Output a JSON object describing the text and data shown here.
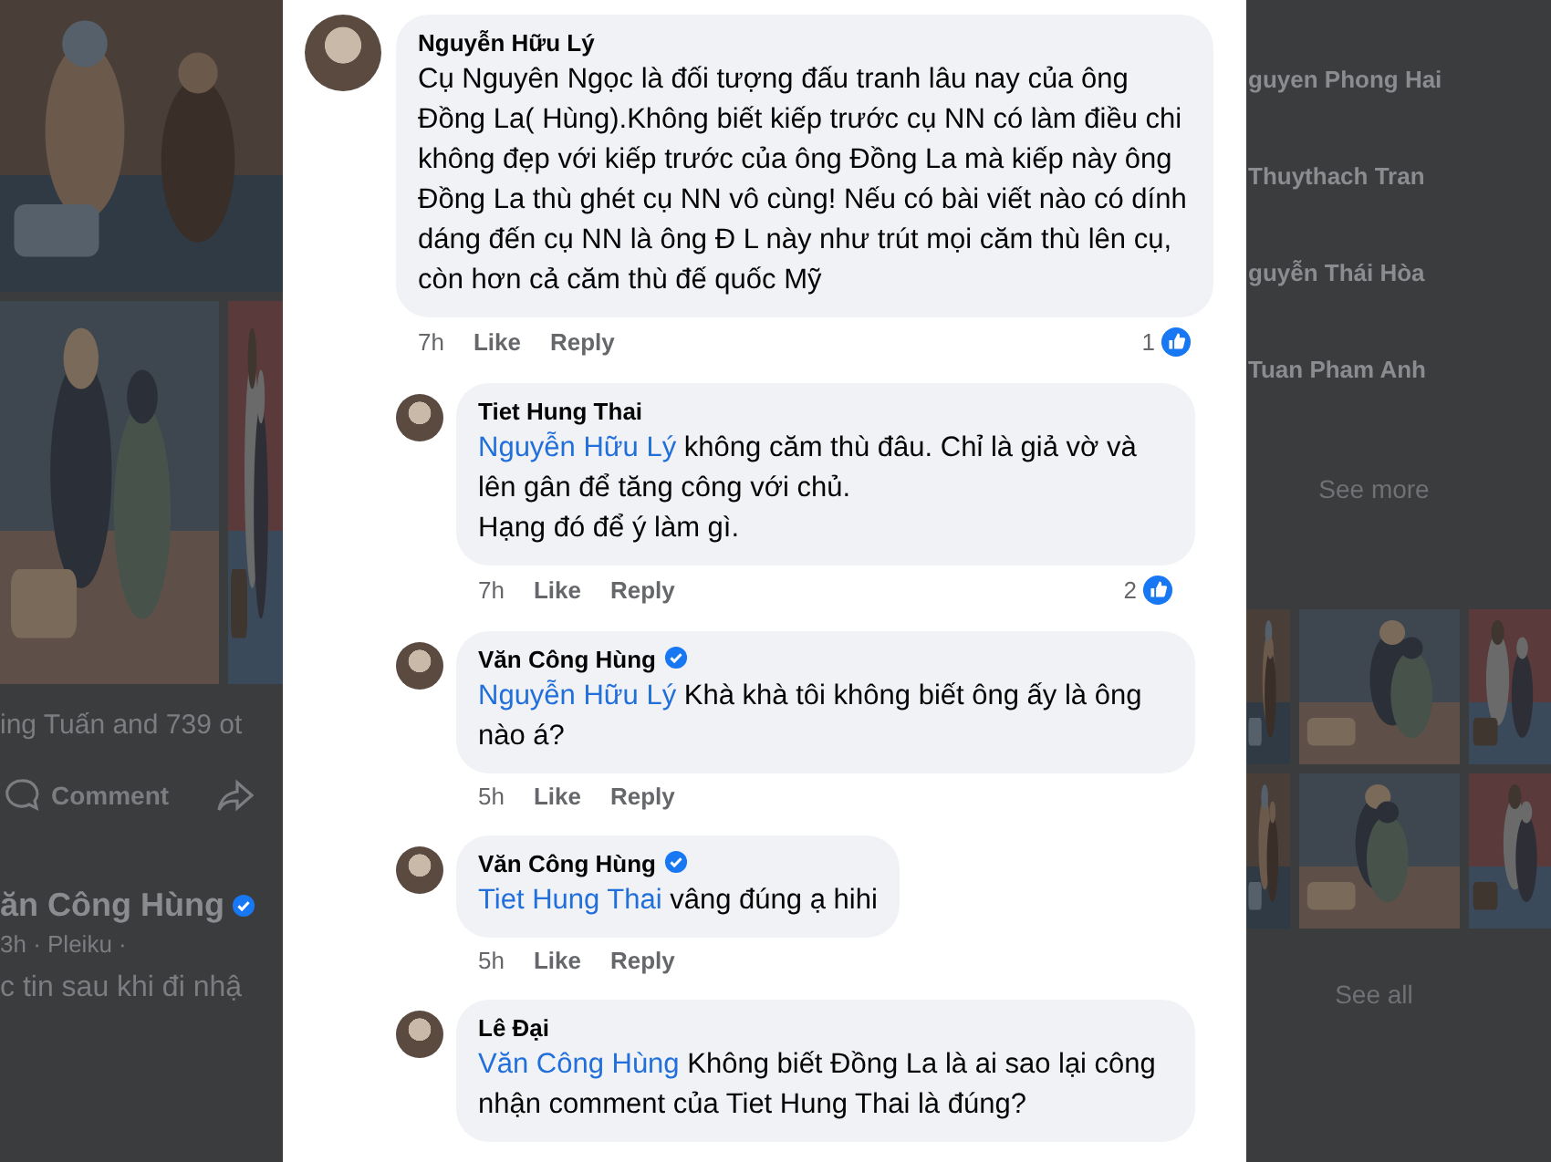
{
  "background_post": {
    "likes_text": "ing Tuấn and 739 ot",
    "comment_button": "Comment",
    "author": "ăn Công Hùng",
    "author_verified": true,
    "meta": "3h · Pleiku ·",
    "text": "c tin sau khi đi nhậ"
  },
  "sidebar": {
    "people": [
      {
        "name": "guyen Phong Hai"
      },
      {
        "name": "Thuythach Tran"
      },
      {
        "name": "guyễn Thái Hòa"
      },
      {
        "name": "Tuan Pham Anh"
      }
    ],
    "see_more": "See more",
    "see_all": "See all"
  },
  "comments": [
    {
      "author": "Nguyễn Hữu Lý",
      "verified": false,
      "reply": false,
      "text": "Cụ Nguyên Ngọc là đối tượng đấu tranh lâu nay của ông Đồng La( Hùng).Không biết kiếp trước cụ NN có làm điều chi không đẹp với kiếp trước của ông Đồng La mà kiếp này ông Đồng La  thù ghét cụ NN vô cùng! Nếu có bài viết nào có dính dáng  đến cụ NN là ông Đ L này như trút mọi căm thù lên cụ, còn hơn cả căm thù đế quốc Mỹ",
      "time": "7h",
      "like": "Like",
      "reply_label": "Reply",
      "reactions": "1"
    },
    {
      "author": "Tiet Hung Thai",
      "verified": false,
      "reply": true,
      "mention": "Nguyễn Hữu Lý",
      "text": "không căm thù đâu. Chỉ là giả vờ và lên gân để tăng công với chủ.\nHạng đó để ý làm gì.",
      "time": "7h",
      "like": "Like",
      "reply_label": "Reply",
      "reactions": "2"
    },
    {
      "author": "Văn Công Hùng",
      "verified": true,
      "reply": true,
      "mention": "Nguyễn Hữu Lý",
      "text": "Khà khà tôi không biết ông ấy là ông nào á?",
      "time": "5h",
      "like": "Like",
      "reply_label": "Reply"
    },
    {
      "author": "Văn Công Hùng",
      "verified": true,
      "reply": true,
      "mention": "Tiet Hung Thai",
      "text": "vâng đúng ạ hihi",
      "time": "5h",
      "like": "Like",
      "reply_label": "Reply"
    },
    {
      "author": "Lê Đại",
      "verified": false,
      "reply": true,
      "mention": "Văn Công Hùng",
      "text": "Không biết Đồng La là ai sao lại công nhận comment của Tiet Hung Thai là đúng?"
    }
  ]
}
